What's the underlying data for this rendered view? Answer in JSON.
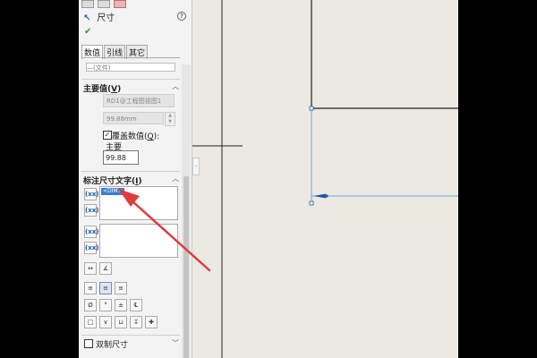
{
  "panel": {
    "title": "尺寸",
    "help_label": "?",
    "ok_label": "✔",
    "tabs": [
      {
        "label": "数值",
        "active": true
      },
      {
        "label": "引线",
        "active": false
      },
      {
        "label": "其它",
        "active": false
      }
    ],
    "cut_row_text": "—(文件)",
    "primary_value": {
      "section_title": "主要值",
      "section_key": "V",
      "reference": "RD1@工程图视图1",
      "value": "99.88mm",
      "override_label": "覆盖数值",
      "override_key": "Q",
      "override_checked": true,
      "primary_label": "主要",
      "primary_input": "99.88"
    },
    "dim_text": {
      "section_title": "标注尺寸文字",
      "section_key": "I",
      "tag": "<DIM>"
    },
    "icons": {
      "parenthesis": "(xx)",
      "inspection": "(xx)",
      "diameter": "Ø",
      "degree": "°",
      "plusminus": "±",
      "centerline": "℄"
    },
    "dual_dimension": {
      "label": "双制尺寸",
      "checked": false
    }
  },
  "colors": {
    "drawing_bg": "#ebe9e2",
    "panel_bg": "#f3f3f3",
    "annotation_arrow": "#e03c3c",
    "dim_highlight": "#3a7fd0",
    "ok_green": "#2c9a2c"
  }
}
